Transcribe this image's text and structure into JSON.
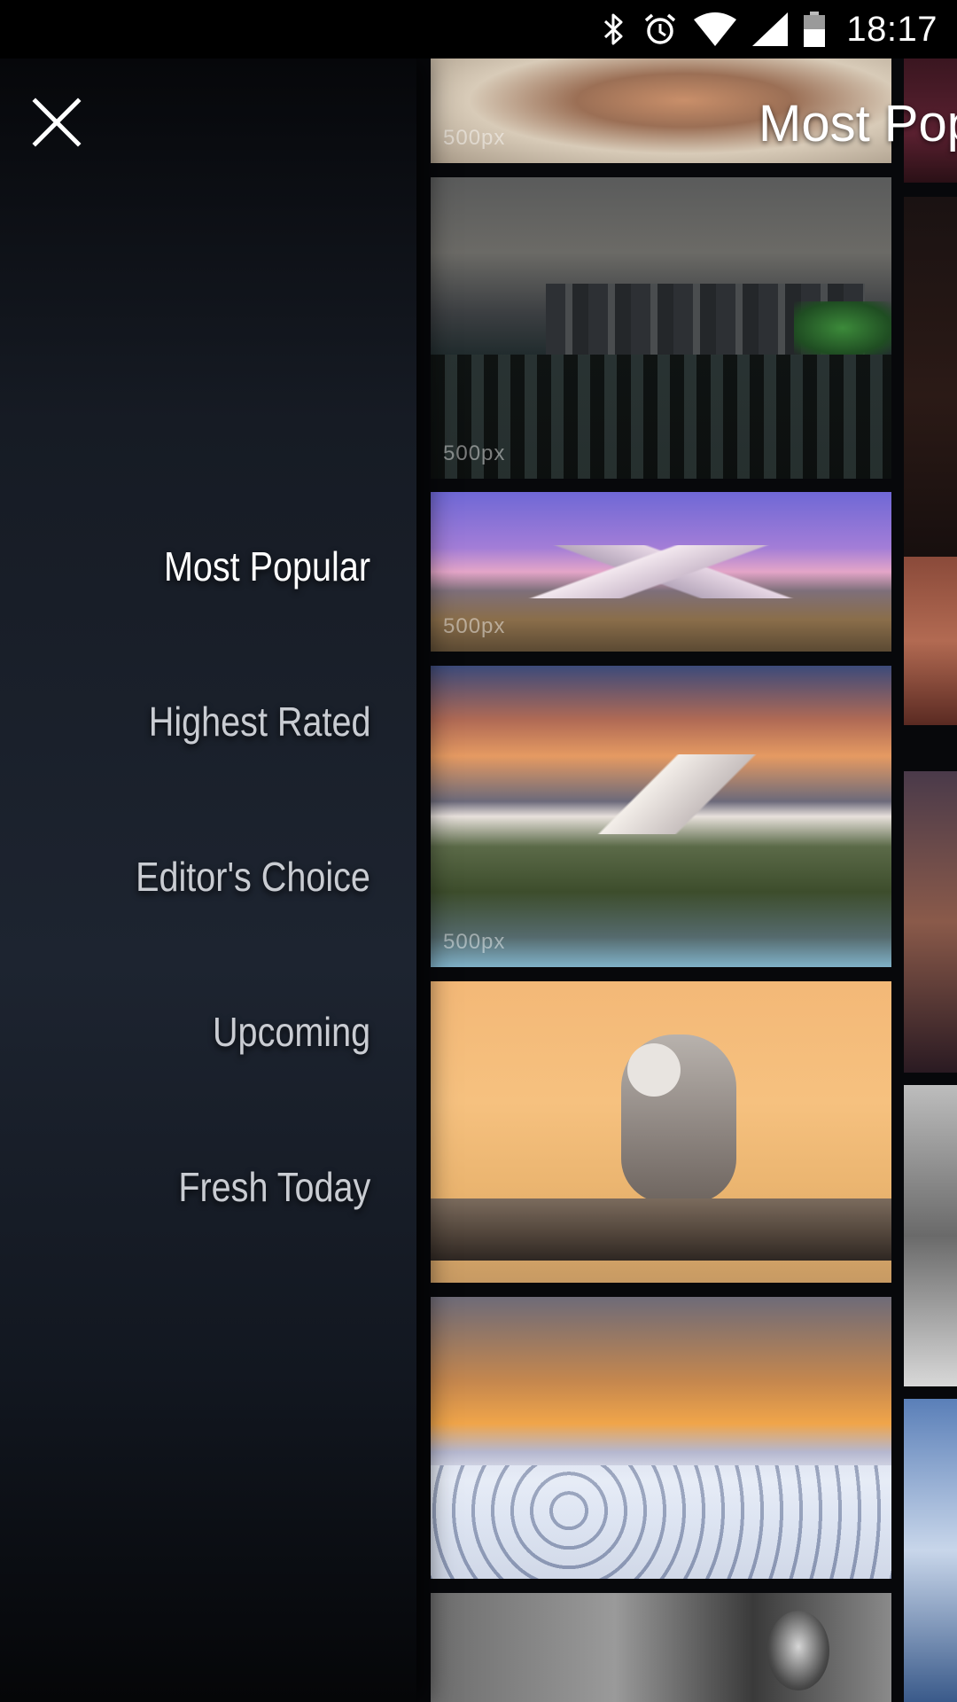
{
  "status_bar": {
    "time": "18:17",
    "icons": [
      "bluetooth-icon",
      "alarm-icon",
      "wifi-icon",
      "cell-signal-icon",
      "battery-icon"
    ]
  },
  "header": {
    "title": "Most Pop"
  },
  "drawer": {
    "close_icon": "close-icon",
    "items": [
      {
        "label": "Most Popular",
        "active": true
      },
      {
        "label": "Highest Rated",
        "active": false
      },
      {
        "label": "Editor's Choice",
        "active": false
      },
      {
        "label": "Upcoming",
        "active": false
      },
      {
        "label": "Fresh Today",
        "active": false
      }
    ]
  },
  "photos": {
    "watermark": "500px"
  },
  "colors": {
    "drawer_bg": "#1d2430",
    "active_text": "#ffffff",
    "inactive_text": "#c9ccd2"
  }
}
